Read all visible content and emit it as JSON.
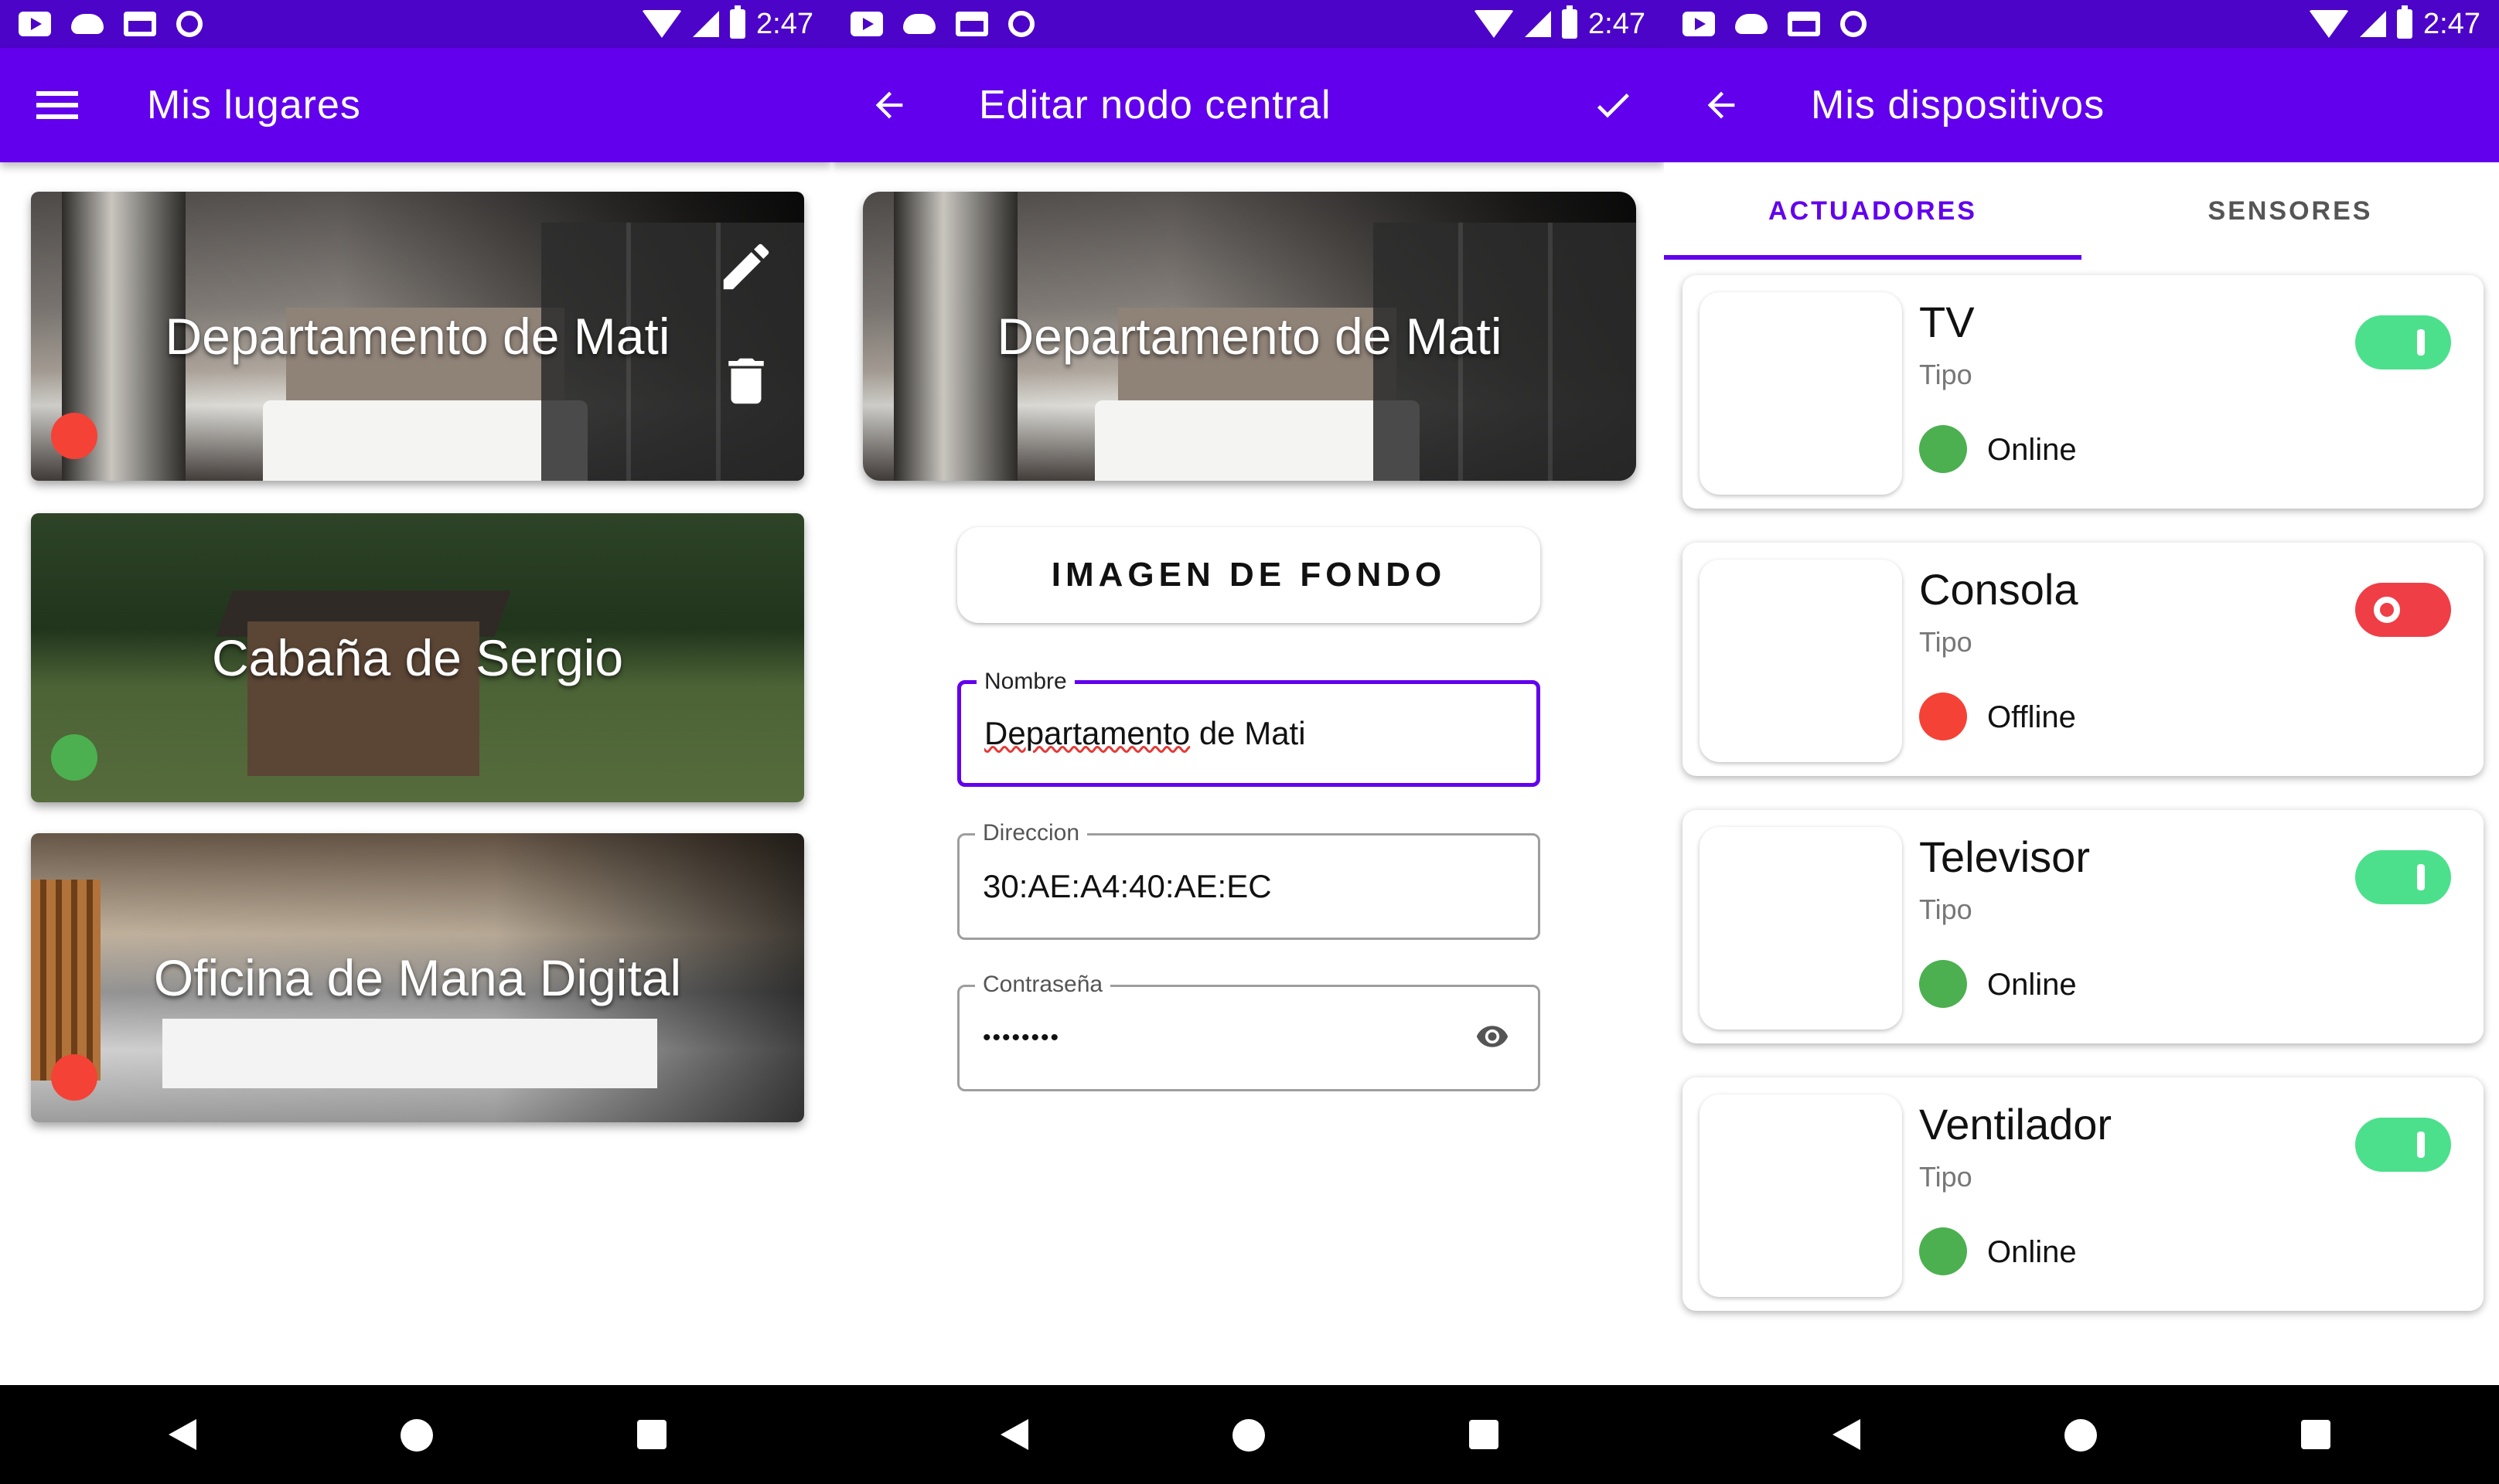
{
  "status_bar": {
    "time": "2:47"
  },
  "colors": {
    "primary": "#6200ee",
    "status_bar": "#4c04c8",
    "online": "#4caf50",
    "offline": "#f44336",
    "toggle_on": "#4ce08c",
    "toggle_off": "#f03e47"
  },
  "screen_places": {
    "title": "Mis lugares",
    "places": [
      {
        "name": "Departamento de Mati",
        "status": "offline"
      },
      {
        "name": "Cabaña de Sergio",
        "status": "online"
      },
      {
        "name": "Oficina de Mana Digital",
        "status": "offline"
      }
    ]
  },
  "screen_edit": {
    "title": "Editar nodo central",
    "hero_name": "Departamento de Mati",
    "background_button": "IMAGEN DE FONDO",
    "fields": {
      "nombre": {
        "label": "Nombre",
        "value_part1": "Departamento",
        "value_part2": " de Mati"
      },
      "direccion": {
        "label": "Direccion",
        "value": "30:AE:A4:40:AE:EC"
      },
      "contrasena": {
        "label": "Contraseña",
        "value": "••••••••"
      }
    }
  },
  "screen_devices": {
    "title": "Mis dispositivos",
    "tabs": [
      "ACTUADORES",
      "SENSORES"
    ],
    "devices": [
      {
        "name": "TV",
        "type": "Tipo",
        "status": "Online",
        "on": true
      },
      {
        "name": "Consola",
        "type": "Tipo",
        "status": "Offline",
        "on": false
      },
      {
        "name": "Televisor",
        "type": "Tipo",
        "status": "Online",
        "on": true
      },
      {
        "name": "Ventilador",
        "type": "Tipo",
        "status": "Online",
        "on": true
      }
    ]
  }
}
